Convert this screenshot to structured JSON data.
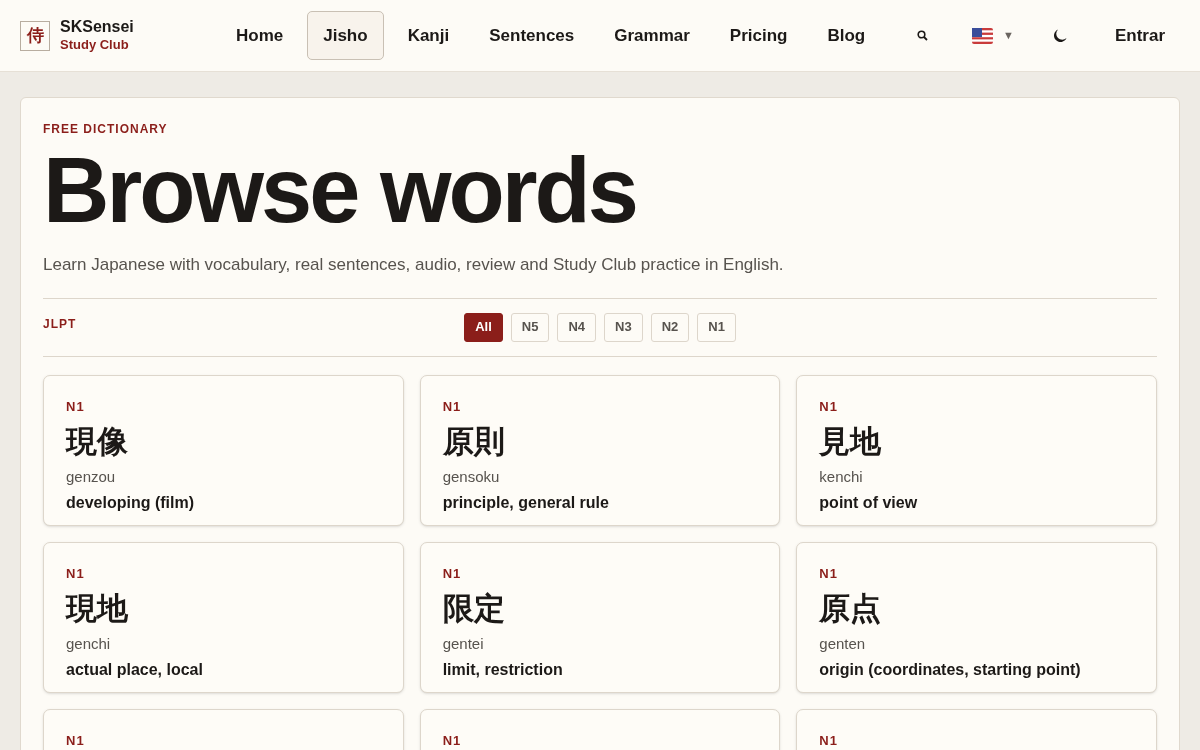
{
  "brand": {
    "logo": "侍",
    "name": "SKSensei",
    "tagline": "Study Club"
  },
  "nav": [
    {
      "label": "Home",
      "selected": false
    },
    {
      "label": "Jisho",
      "selected": true
    },
    {
      "label": "Kanji",
      "selected": false
    },
    {
      "label": "Sentences",
      "selected": false
    },
    {
      "label": "Grammar",
      "selected": false
    },
    {
      "label": "Pricing",
      "selected": false
    },
    {
      "label": "Blog",
      "selected": false
    }
  ],
  "language_caret": "▼",
  "login": "Entrar",
  "eyebrow": "FREE DICTIONARY",
  "title": "Browse words",
  "subtitle": "Learn Japanese with vocabulary, real sentences, audio, review and Study Club practice in English.",
  "filter_label": "JLPT",
  "filters": [
    {
      "label": "All",
      "selected": true
    },
    {
      "label": "N5",
      "selected": false
    },
    {
      "label": "N4",
      "selected": false
    },
    {
      "label": "N3",
      "selected": false
    },
    {
      "label": "N2",
      "selected": false
    },
    {
      "label": "N1",
      "selected": false
    }
  ],
  "words": [
    {
      "level": "N1",
      "word": "現像",
      "reading": "genzou",
      "meaning": "developing (film)"
    },
    {
      "level": "N1",
      "word": "原則",
      "reading": "gensoku",
      "meaning": "principle, general rule"
    },
    {
      "level": "N1",
      "word": "見地",
      "reading": "kenchi",
      "meaning": "point of view"
    },
    {
      "level": "N1",
      "word": "現地",
      "reading": "genchi",
      "meaning": "actual place, local"
    },
    {
      "level": "N1",
      "word": "限定",
      "reading": "gentei",
      "meaning": "limit, restriction"
    },
    {
      "level": "N1",
      "word": "原点",
      "reading": "genten",
      "meaning": "origin (coordinates, starting point)"
    },
    {
      "level": "N1"
    },
    {
      "level": "N1"
    },
    {
      "level": "N1"
    }
  ]
}
